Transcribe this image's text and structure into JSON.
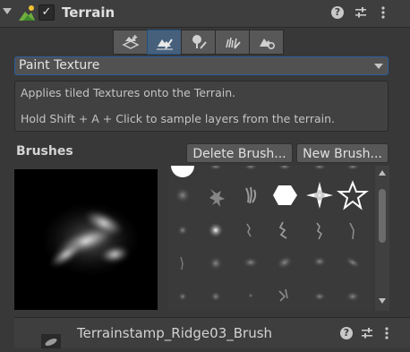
{
  "header": {
    "title": "Terrain",
    "enabled": true,
    "checkbox_glyph": "✓",
    "icons": [
      "terrain-icon",
      "help-icon",
      "presets-icon",
      "kebab-menu-icon"
    ]
  },
  "toolbar": {
    "tools": [
      {
        "icon": "create-neighbor-terrain-icon",
        "active": false
      },
      {
        "icon": "paint-terrain-icon",
        "active": true
      },
      {
        "icon": "paint-trees-icon",
        "active": false
      },
      {
        "icon": "paint-details-icon",
        "active": false
      },
      {
        "icon": "terrain-settings-icon",
        "active": false
      }
    ]
  },
  "dropdown": {
    "selected": "Paint Texture"
  },
  "description": {
    "line1": "Applies tiled Textures onto the Terrain.",
    "line2": "Hold Shift + A + Click to sample layers from the terrain."
  },
  "brushes": {
    "heading": "Brushes",
    "delete_label": "Delete Brush...",
    "new_label": "New Brush..."
  },
  "selected_brush": {
    "name": "Terrainstamp_Ridge03_Brush"
  },
  "colors": {
    "accent": "#2a5ea0",
    "active_tool": "#46607c",
    "panel": "#383838"
  }
}
